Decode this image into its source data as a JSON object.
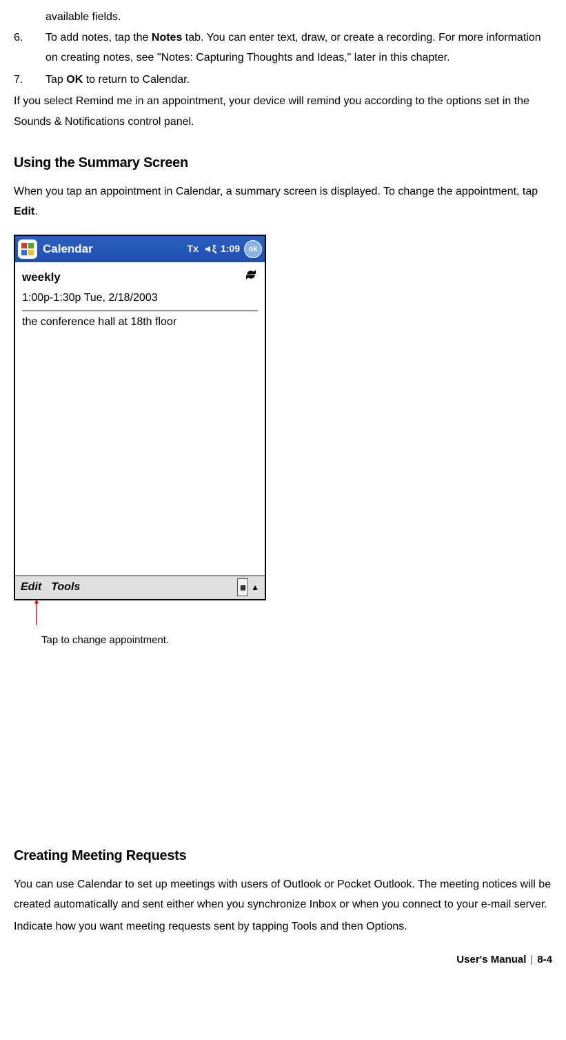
{
  "intro_line": "available fields.",
  "item6": {
    "num": "6.",
    "pre": "To add notes, tap the ",
    "bold1": "Notes",
    "post": " tab. You can enter text, draw, or create a recording. For more information on creating notes, see \"Notes: Capturing Thoughts and Ideas,\" later in this chapter."
  },
  "item7": {
    "num": "7.",
    "pre": "Tap ",
    "bold1": "OK",
    "post": " to return to Calendar."
  },
  "remind_para": "If you select Remind me in an appointment, your device will remind you according to the options set in the Sounds & Notifications control panel.",
  "section1_title": "Using the Summary Screen",
  "section1_body_pre": "When you tap an appointment in Calendar, a summary screen is displayed. To change the appointment, tap ",
  "section1_body_bold": "Edit",
  "section1_body_post": ".",
  "screenshot": {
    "app_title": "Calendar",
    "signal_icon": "Tx",
    "speaker_icon": "◄ξ",
    "time": "1:09",
    "ok_label": "ok",
    "subject": "weekly",
    "datetime": "1:00p-1:30p Tue, 2/18/2003",
    "location": "the conference hall at 18th floor",
    "menu_edit": "Edit",
    "menu_tools": "Tools",
    "keyboard_glyph": "▦",
    "arrow_glyph": "▲"
  },
  "callout": "Tap to change appointment.",
  "section2_title": "Creating Meeting Requests",
  "section2_para1": "You can use Calendar to set up meetings with users of Outlook or Pocket Outlook. The meeting notices will be created automatically and sent either when you synchronize Inbox or when you connect to your e-mail server.",
  "section2_para2": "Indicate how you want meeting requests sent by tapping Tools and then Options.",
  "footer_left": "User's Manual",
  "footer_right": "8-4"
}
